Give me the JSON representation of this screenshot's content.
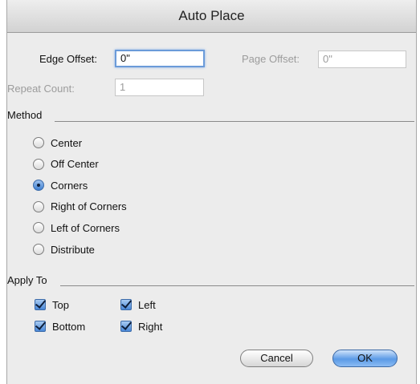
{
  "window": {
    "title": "Auto Place"
  },
  "offsets": {
    "edge_label": "Edge Offset:",
    "edge_value": "0\"",
    "page_label": "Page Offset:",
    "page_value": "0\"",
    "repeat_label": "Repeat Count:",
    "repeat_value": "1"
  },
  "method": {
    "heading": "Method",
    "options": [
      "Center",
      "Off Center",
      "Corners",
      "Right of Corners",
      "Left of Corners",
      "Distribute"
    ],
    "selected": "Corners"
  },
  "apply_to": {
    "heading": "Apply To",
    "top": "Top",
    "bottom": "Bottom",
    "left": "Left",
    "right": "Right",
    "checked": [
      "Top",
      "Bottom",
      "Left",
      "Right"
    ]
  },
  "buttons": {
    "cancel": "Cancel",
    "ok": "OK"
  }
}
